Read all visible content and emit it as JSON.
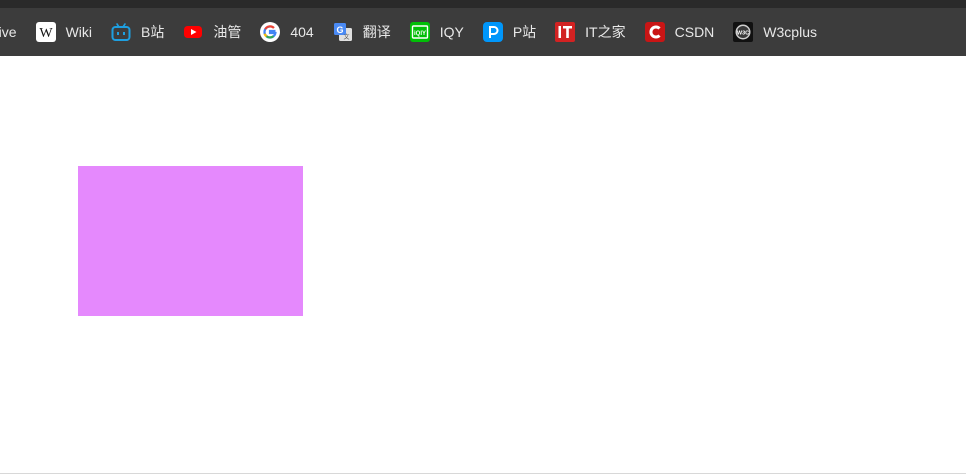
{
  "bookmarks": [
    {
      "label": "rive",
      "icon": "none"
    },
    {
      "label": "Wiki",
      "icon": "wikipedia-icon"
    },
    {
      "label": "B站",
      "icon": "bilibili-icon"
    },
    {
      "label": "油管",
      "icon": "youtube-icon"
    },
    {
      "label": "404",
      "icon": "google-icon"
    },
    {
      "label": "翻译",
      "icon": "translate-icon"
    },
    {
      "label": "IQY",
      "icon": "iqiyi-icon"
    },
    {
      "label": "P站",
      "icon": "pixiv-icon"
    },
    {
      "label": "IT之家",
      "icon": "ithome-icon"
    },
    {
      "label": "CSDN",
      "icon": "csdn-icon"
    },
    {
      "label": "W3cplus",
      "icon": "w3cplus-icon"
    }
  ],
  "colors": {
    "bar_background": "#3c3c3c",
    "bar_text": "#e8e8e8",
    "page_background": "#ffffff",
    "box_fill": "#e589fd"
  }
}
